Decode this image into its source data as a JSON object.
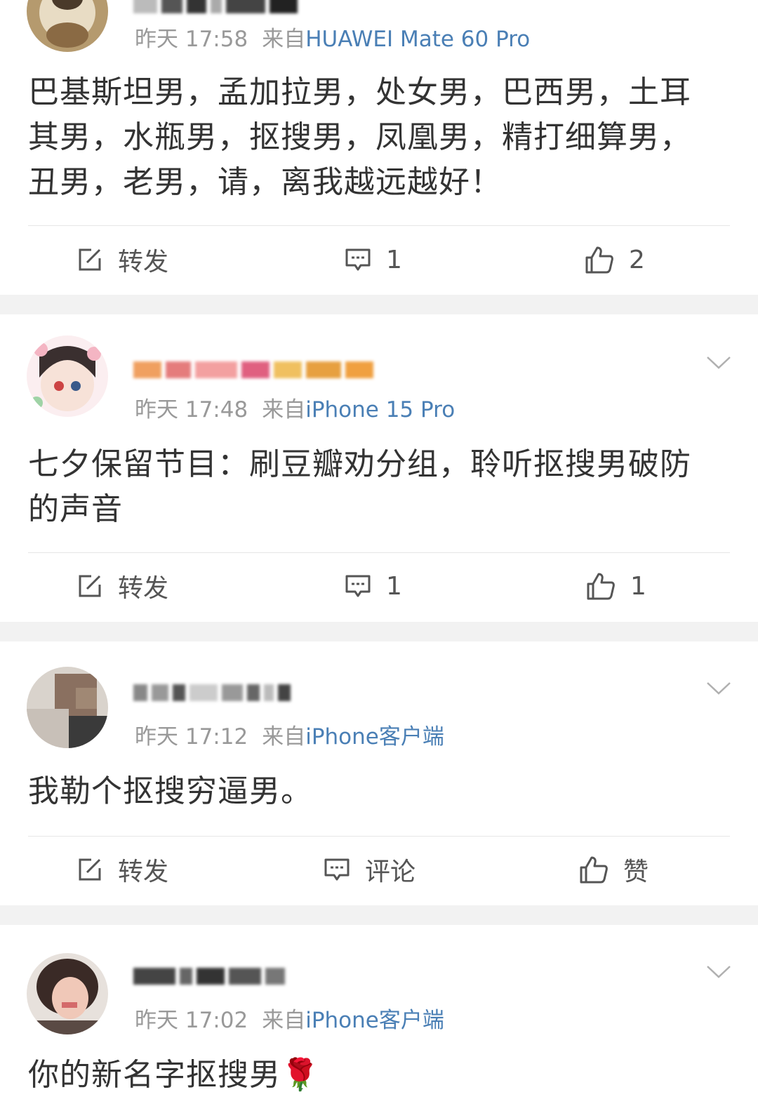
{
  "posts": [
    {
      "time": "昨天 17:58",
      "from_label": "来自",
      "device": "HUAWEI Mate 60 Pro",
      "text": "巴基斯坦男，孟加拉男，处女男，巴西男，土耳其男，水瓶男，抠搜男，凤凰男，精打细算男，丑男，老男，请，离我越远越好！",
      "actions": {
        "repost": "转发",
        "comment": "1",
        "like": "2"
      }
    },
    {
      "time": "昨天 17:48",
      "from_label": "来自",
      "device": "iPhone 15 Pro",
      "text": "七夕保留节目：刷豆瓣劝分组，聆听抠搜男破防的声音",
      "actions": {
        "repost": "转发",
        "comment": "1",
        "like": "1"
      }
    },
    {
      "time": "昨天 17:12",
      "from_label": "来自",
      "device": "iPhone客户端",
      "text": "我勒个抠搜穷逼男。",
      "actions": {
        "repost": "转发",
        "comment": "评论",
        "like": "赞"
      }
    },
    {
      "time": "昨天 17:02",
      "from_label": "来自",
      "device": "iPhone客户端",
      "text": "你的新名字抠搜男🌹"
    }
  ],
  "icons": {
    "repost": "repost-icon",
    "comment": "comment-icon",
    "like": "thumbs-up-icon",
    "more": "chevron-down-icon"
  },
  "colors": {
    "device_link": "#4a7fb5",
    "meta_gray": "#999999",
    "separator": "#f2f2f2"
  }
}
